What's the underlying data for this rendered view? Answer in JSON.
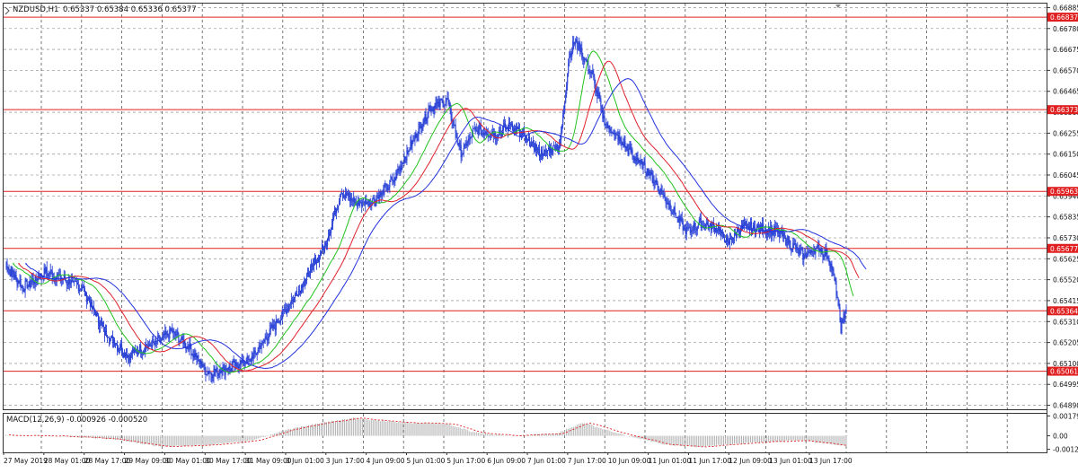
{
  "header": {
    "symbol": "NZDUSD,H1",
    "ohlc": "0.65337 0.65384 0.65336 0.65377"
  },
  "macd_header": {
    "label": "MACD(12,26,9) -0.000926 -0.000520"
  },
  "colors": {
    "background": "#ffffff",
    "grid": "#555555",
    "candle": "#2b43d6",
    "ma_fast": "#22c21e",
    "ma_mid": "#e0202a",
    "ma_slow": "#2233dd",
    "level_line": "#e02020",
    "level_label_bg": "#e02020",
    "macd_hist": "#b0b0b0",
    "macd_signal": "#e02020"
  },
  "chart_data": [
    {
      "type": "candlestick",
      "title": "NZDUSD,H1",
      "y_ticks": [
        0.66885,
        0.6678,
        0.66675,
        0.6657,
        0.66465,
        0.6636,
        0.66255,
        0.6615,
        0.66045,
        0.6594,
        0.65835,
        0.6573,
        0.65625,
        0.6552,
        0.65415,
        0.6531,
        0.65205,
        0.651,
        0.64995,
        0.6489
      ],
      "y_tick_labels": [
        "0.66885",
        "0.66780",
        "0.66675",
        "0.66570",
        "0.66465",
        "0.66360",
        "0.66255",
        "0.66150",
        "0.66045",
        "0.65940",
        "0.65835",
        "0.65730",
        "0.65625",
        "0.65520",
        "0.65415",
        "0.65310",
        "0.65205",
        "0.65100",
        "0.64995",
        "0.64890"
      ],
      "ylim": [
        0.6487,
        0.66905
      ],
      "horizontal_levels": [
        {
          "value": 0.66837,
          "label": "0.66837"
        },
        {
          "value": 0.66373,
          "label": "0.66373"
        },
        {
          "value": 0.65963,
          "label": "0.65963"
        },
        {
          "value": 0.65677,
          "label": "0.65677"
        },
        {
          "value": 0.65364,
          "label": "0.65364"
        },
        {
          "value": 0.65061,
          "label": "0.65061"
        }
      ],
      "x_labels": [
        "27 May 2019",
        "28 May 01:00",
        "28 May 17:00",
        "29 May 09:00",
        "30 May 01:00",
        "30 May 17:00",
        "31 May 09:00",
        "3 Jun 01:00",
        "3 Jun 17:00",
        "4 Jun 09:00",
        "5 Jun 01:00",
        "5 Jun 17:00",
        "6 Jun 09:00",
        "7 Jun 01:00",
        "7 Jun 17:00",
        "10 Jun 09:00",
        "11 Jun 01:00",
        "11 Jun 17:00",
        "12 Jun 09:00",
        "13 Jun 01:00",
        "13 Jun 17:00"
      ],
      "key_points": [
        {
          "t": 0,
          "price": 0.656
        },
        {
          "t": 20,
          "price": 0.6548
        },
        {
          "t": 45,
          "price": 0.6556
        },
        {
          "t": 85,
          "price": 0.6548
        },
        {
          "t": 110,
          "price": 0.6526
        },
        {
          "t": 135,
          "price": 0.6514
        },
        {
          "t": 165,
          "price": 0.652
        },
        {
          "t": 185,
          "price": 0.6526
        },
        {
          "t": 205,
          "price": 0.6517
        },
        {
          "t": 225,
          "price": 0.6505
        },
        {
          "t": 250,
          "price": 0.6508
        },
        {
          "t": 272,
          "price": 0.6512
        },
        {
          "t": 300,
          "price": 0.653
        },
        {
          "t": 330,
          "price": 0.655
        },
        {
          "t": 355,
          "price": 0.657
        },
        {
          "t": 372,
          "price": 0.6596
        },
        {
          "t": 390,
          "price": 0.659
        },
        {
          "t": 410,
          "price": 0.6592
        },
        {
          "t": 430,
          "price": 0.6602
        },
        {
          "t": 450,
          "price": 0.662
        },
        {
          "t": 470,
          "price": 0.6638
        },
        {
          "t": 490,
          "price": 0.6642
        },
        {
          "t": 505,
          "price": 0.6615
        },
        {
          "t": 520,
          "price": 0.6627
        },
        {
          "t": 545,
          "price": 0.6625
        },
        {
          "t": 560,
          "price": 0.663
        },
        {
          "t": 575,
          "price": 0.6623
        },
        {
          "t": 595,
          "price": 0.6615
        },
        {
          "t": 615,
          "price": 0.662
        },
        {
          "t": 625,
          "price": 0.6665
        },
        {
          "t": 632,
          "price": 0.6672
        },
        {
          "t": 650,
          "price": 0.6655
        },
        {
          "t": 665,
          "price": 0.663
        },
        {
          "t": 690,
          "price": 0.6617
        },
        {
          "t": 715,
          "price": 0.6605
        },
        {
          "t": 735,
          "price": 0.659
        },
        {
          "t": 755,
          "price": 0.6576
        },
        {
          "t": 770,
          "price": 0.658
        },
        {
          "t": 790,
          "price": 0.6578
        },
        {
          "t": 800,
          "price": 0.657
        },
        {
          "t": 815,
          "price": 0.6578
        },
        {
          "t": 835,
          "price": 0.6578
        },
        {
          "t": 855,
          "price": 0.6576
        },
        {
          "t": 870,
          "price": 0.657
        },
        {
          "t": 885,
          "price": 0.6564
        },
        {
          "t": 900,
          "price": 0.6568
        },
        {
          "t": 912,
          "price": 0.6564
        },
        {
          "t": 920,
          "price": 0.655
        },
        {
          "t": 926,
          "price": 0.6528
        },
        {
          "t": 932,
          "price": 0.6537
        }
      ]
    },
    {
      "type": "bar",
      "title": "MACD(12,26,9)",
      "y_tick_labels": [
        "0.001799",
        "0.00",
        "-0.001226"
      ],
      "ylim": [
        -0.0015,
        0.002
      ],
      "key_points": [
        {
          "t": 0,
          "macd": 5e-05
        },
        {
          "t": 60,
          "macd": -2e-05
        },
        {
          "t": 120,
          "macd": -0.0003
        },
        {
          "t": 175,
          "macd": -0.001
        },
        {
          "t": 230,
          "macd": -0.0008
        },
        {
          "t": 275,
          "macd": -0.0004
        },
        {
          "t": 310,
          "macd": 0.0005
        },
        {
          "t": 345,
          "macd": 0.0011
        },
        {
          "t": 385,
          "macd": 0.0016
        },
        {
          "t": 440,
          "macd": 0.0012
        },
        {
          "t": 490,
          "macd": 0.0011
        },
        {
          "t": 520,
          "macd": 0.0003
        },
        {
          "t": 560,
          "macd": 0.0
        },
        {
          "t": 610,
          "macd": 0.0002
        },
        {
          "t": 640,
          "macd": 0.0012
        },
        {
          "t": 680,
          "macd": 0.0002
        },
        {
          "t": 730,
          "macd": -0.0008
        },
        {
          "t": 770,
          "macd": -0.001
        },
        {
          "t": 830,
          "macd": -0.0006
        },
        {
          "t": 880,
          "macd": -0.0004
        },
        {
          "t": 932,
          "macd": -0.00093
        }
      ]
    }
  ]
}
